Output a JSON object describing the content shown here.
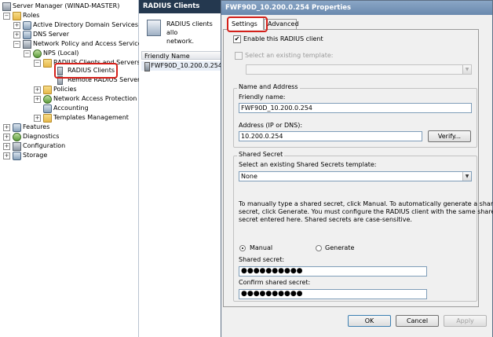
{
  "tree": {
    "items": [
      {
        "label": "Server Manager (WINAD-MASTER)"
      },
      {
        "label": "Roles"
      },
      {
        "label": "Active Directory Domain Services"
      },
      {
        "label": "DNS Server"
      },
      {
        "label": "Network Policy and Access Services"
      },
      {
        "label": "NPS (Local)"
      },
      {
        "label": "RADIUS Clients and Servers"
      },
      {
        "label": "RADIUS Clients"
      },
      {
        "label": "Remote RADIUS Server"
      },
      {
        "label": "Policies"
      },
      {
        "label": "Network Access Protection"
      },
      {
        "label": "Accounting"
      },
      {
        "label": "Templates Management"
      },
      {
        "label": "Features"
      },
      {
        "label": "Diagnostics"
      },
      {
        "label": "Configuration"
      },
      {
        "label": "Storage"
      }
    ]
  },
  "middle": {
    "header": "RADIUS Clients",
    "description_line1": "RADIUS clients allo",
    "description_line2": "network.",
    "column_header": "Friendly Name",
    "rows": [
      "FWF90D_10.200.0.254"
    ]
  },
  "dialog": {
    "title": "FWF90D_10.200.0.254 Properties",
    "tabs": [
      "Settings",
      "Advanced"
    ],
    "enable_label": "Enable this RADIUS client",
    "select_template_label": "Select an existing template:",
    "name_address_group": "Name and Address",
    "friendly_name_label": "Friendly name:",
    "friendly_name_value": "FWF90D_10.200.0.254",
    "address_label": "Address (IP or DNS):",
    "address_value": "10.200.0.254",
    "verify_button": "Verify...",
    "shared_secret_group": "Shared Secret",
    "shared_template_label": "Select an existing Shared Secrets template:",
    "shared_template_value": "None",
    "info_line1": "To manually type a shared secret, click Manual. To automatically generate a shared",
    "info_line2": "secret, click Generate. You must configure the RADIUS client with the same shared",
    "info_line3": "secret entered here. Shared secrets are case-sensitive.",
    "manual_label": "Manual",
    "generate_label": "Generate",
    "shared_secret_label": "Shared secret:",
    "shared_secret_value": "●●●●●●●●●●",
    "confirm_label": "Confirm shared secret:",
    "confirm_value": "●●●●●●●●●●",
    "ok_button": "OK",
    "cancel_button": "Cancel",
    "apply_button": "Apply"
  },
  "colors": {
    "highlight_outline": "#d4201a",
    "title_bar": "#7593b8",
    "middle_header": "#24384f"
  }
}
